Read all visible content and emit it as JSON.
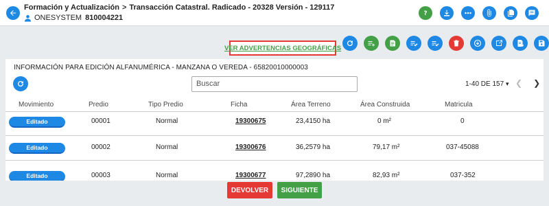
{
  "header": {
    "breadcrumb_1": "Formación y Actualización",
    "separator": ">",
    "breadcrumb_2": "Transacción Catastral. Radicado - 20328 Versión - 129117",
    "user_name": "ONESYSTEM",
    "user_code": "810004221",
    "icons": [
      "help-icon",
      "download-icon",
      "more-icon",
      "attach-icon",
      "documents-icon",
      "notes-icon"
    ]
  },
  "toolbar": {
    "geo_warnings_link": "VER ADVERTENCIAS GEOGRÁFICAS",
    "action_icons": [
      "refresh-icon",
      "add-list-icon",
      "edit-doc-icon",
      "checklist-icon",
      "checklist-2-icon",
      "delete-icon",
      "circle-down-icon",
      "export-icon",
      "doc-settings-icon",
      "save-icon"
    ]
  },
  "panel": {
    "title": "INFORMACIÓN PARA EDICIÓN ALFANUMÉRICA - MANZANA O VEREDA - 65820010000003",
    "search_placeholder": "Buscar",
    "pager_text": "1-40 DE 157",
    "pager_dropdown": "▾"
  },
  "table": {
    "columns": [
      "Movimiento",
      "Predio",
      "Tipo Predio",
      "Ficha",
      "Área Terreno",
      "Área Construida",
      "Matricula"
    ],
    "rows": [
      {
        "movimiento": "Editado",
        "predio": "00001",
        "tipo": "Normal",
        "ficha": "19300675",
        "area_terreno": "23,4150 ha",
        "area_construida": "0 m²",
        "matricula": "0"
      },
      {
        "movimiento": "Editado",
        "predio": "00002",
        "tipo": "Normal",
        "ficha": "19300676",
        "area_terreno": "36,2579 ha",
        "area_construida": "79,17 m²",
        "matricula": "037-45088"
      },
      {
        "movimiento": "Editado",
        "predio": "00003",
        "tipo": "Normal",
        "ficha": "19300677",
        "area_terreno": "97,2890 ha",
        "area_construida": "82,93 m²",
        "matricula": "037-352"
      }
    ]
  },
  "footer": {
    "devolver_label": "DEVOLVER",
    "siguiente_label": "SIGUIENTE"
  },
  "colors": {
    "primary_blue": "#1e88e5",
    "success_green": "#43a047",
    "danger_red": "#e53935"
  }
}
